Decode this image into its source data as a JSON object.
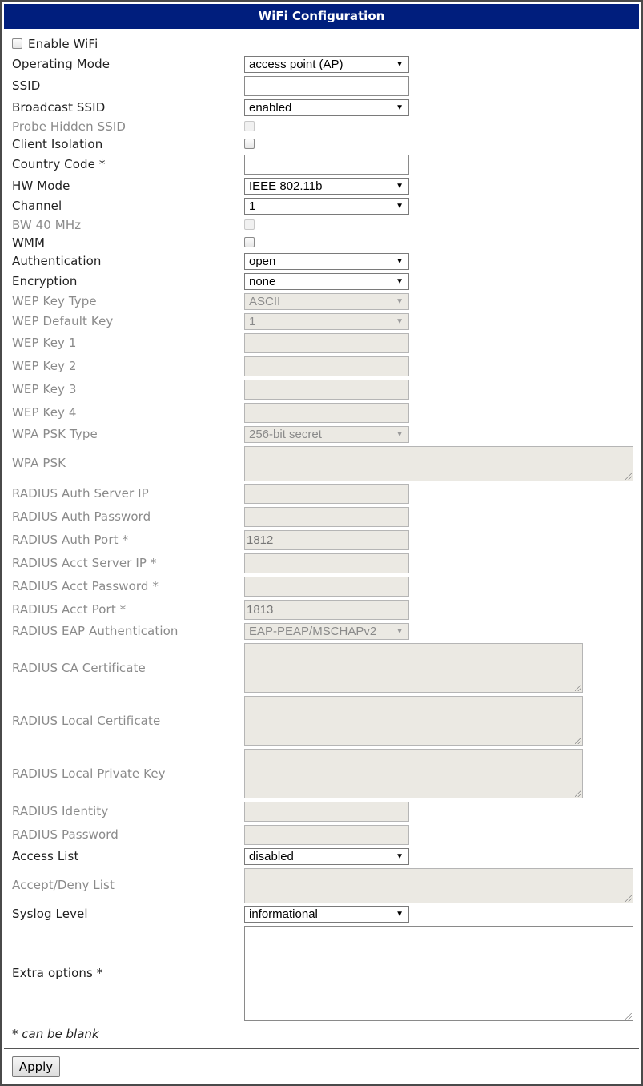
{
  "window": {
    "title": "WiFi Configuration"
  },
  "form": {
    "enable_wifi_label": "Enable WiFi",
    "operating_mode": {
      "label": "Operating Mode",
      "value": "access point (AP)"
    },
    "ssid": {
      "label": "SSID",
      "value": ""
    },
    "broadcast_ssid": {
      "label": "Broadcast SSID",
      "value": "enabled"
    },
    "probe_hidden_ssid": {
      "label": "Probe Hidden SSID"
    },
    "client_isolation": {
      "label": "Client Isolation"
    },
    "country_code": {
      "label": "Country Code *",
      "value": ""
    },
    "hw_mode": {
      "label": "HW Mode",
      "value": "IEEE 802.11b"
    },
    "channel": {
      "label": "Channel",
      "value": "1"
    },
    "bw40": {
      "label": "BW 40 MHz"
    },
    "wmm": {
      "label": "WMM"
    },
    "authentication": {
      "label": "Authentication",
      "value": "open"
    },
    "encryption": {
      "label": "Encryption",
      "value": "none"
    },
    "wep_key_type": {
      "label": "WEP Key Type",
      "value": "ASCII"
    },
    "wep_default_key": {
      "label": "WEP Default Key",
      "value": "1"
    },
    "wep_key_1": {
      "label": "WEP Key 1",
      "value": ""
    },
    "wep_key_2": {
      "label": "WEP Key 2",
      "value": ""
    },
    "wep_key_3": {
      "label": "WEP Key 3",
      "value": ""
    },
    "wep_key_4": {
      "label": "WEP Key 4",
      "value": ""
    },
    "wpa_psk_type": {
      "label": "WPA PSK Type",
      "value": "256-bit secret"
    },
    "wpa_psk": {
      "label": "WPA PSK"
    },
    "radius_auth_server_ip": {
      "label": "RADIUS Auth Server IP",
      "value": ""
    },
    "radius_auth_password": {
      "label": "RADIUS Auth Password",
      "value": ""
    },
    "radius_auth_port": {
      "label": "RADIUS Auth Port *",
      "value": "1812"
    },
    "radius_acct_server_ip": {
      "label": "RADIUS Acct Server IP *",
      "value": ""
    },
    "radius_acct_password": {
      "label": "RADIUS Acct Password *",
      "value": ""
    },
    "radius_acct_port": {
      "label": "RADIUS Acct Port *",
      "value": "1813"
    },
    "radius_eap_auth": {
      "label": "RADIUS EAP Authentication",
      "value": "EAP-PEAP/MSCHAPv2"
    },
    "radius_ca_cert": {
      "label": "RADIUS CA Certificate"
    },
    "radius_local_cert": {
      "label": "RADIUS Local Certificate"
    },
    "radius_local_key": {
      "label": "RADIUS Local Private Key"
    },
    "radius_identity": {
      "label": "RADIUS Identity",
      "value": ""
    },
    "radius_password": {
      "label": "RADIUS Password",
      "value": ""
    },
    "access_list": {
      "label": "Access List",
      "value": "disabled"
    },
    "accept_deny_list": {
      "label": "Accept/Deny List"
    },
    "syslog_level": {
      "label": "Syslog Level",
      "value": "informational"
    },
    "extra_options": {
      "label": "Extra options *"
    },
    "footnote": "* can be blank",
    "apply_label": "Apply"
  }
}
